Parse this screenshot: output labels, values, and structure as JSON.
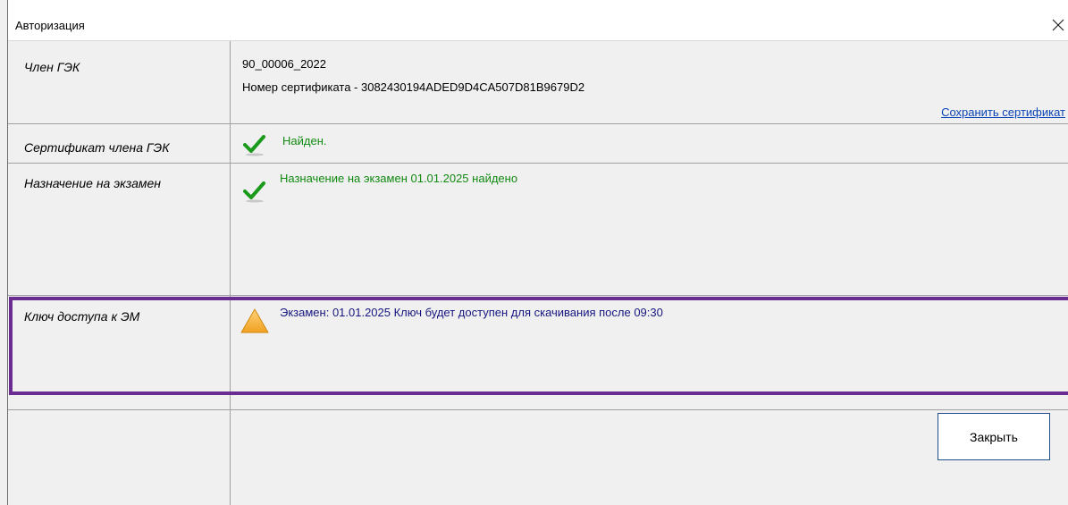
{
  "window": {
    "title": "Авторизация",
    "close_glyph": "✕"
  },
  "rows": {
    "member": {
      "label": "Член ГЭК",
      "id": "90_00006_2022",
      "certificate_number": "Номер сертификата - 3082430194ADED9D4CA507D81B9679D2",
      "save_link": "Сохранить сертификат"
    },
    "certificate": {
      "label": "Сертификат члена ГЭК",
      "status": "Найден.",
      "icon": "checkmark-icon"
    },
    "assignment": {
      "label": "Назначение на экзамен",
      "status": "Назначение на экзамен 01.01.2025 найдено",
      "icon": "checkmark-icon"
    },
    "access_key": {
      "label": "Ключ доступа к ЭМ",
      "status": "Экзамен: 01.01.2025  Ключ будет доступен для скачивания после  09:30",
      "icon": "warning-icon"
    }
  },
  "footer": {
    "close_button": "Закрыть"
  },
  "colors": {
    "success": "#118a11",
    "info": "#161680",
    "link": "#0b44b5",
    "highlight": "#6a2c91",
    "button_border": "#1f4e8c"
  }
}
